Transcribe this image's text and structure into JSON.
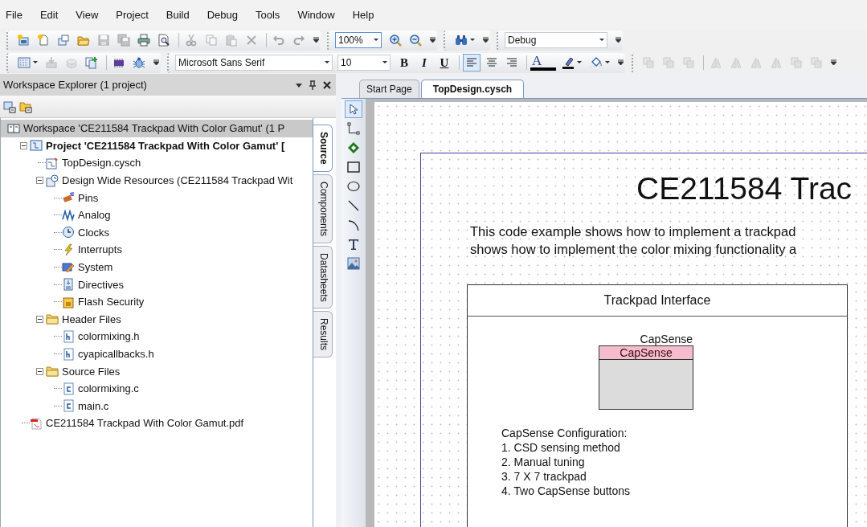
{
  "menu": [
    {
      "label": "File"
    },
    {
      "label": "Edit"
    },
    {
      "label": "View"
    },
    {
      "label": "Project"
    },
    {
      "label": "Build"
    },
    {
      "label": "Debug"
    },
    {
      "label": "Tools"
    },
    {
      "label": "Window"
    },
    {
      "label": "Help"
    }
  ],
  "toolbars": [
    [
      {
        "items": [
          {
            "kind": "icon",
            "disabled": false
          },
          {
            "kind": "icon",
            "disabled": false
          },
          {
            "kind": "icon",
            "disabled": false
          },
          {
            "kind": "icon",
            "disabled": false
          },
          {
            "kind": "icon",
            "disabled": true
          },
          {
            "kind": "icon",
            "disabled": true
          },
          {
            "kind": "icon",
            "disabled": false
          },
          {
            "kind": "icon",
            "disabled": false
          },
          {
            "kind": "separator"
          },
          {
            "kind": "icon",
            "disabled": true
          },
          {
            "kind": "icon",
            "disabled": true
          },
          {
            "kind": "icon",
            "disabled": true
          },
          {
            "kind": "icon",
            "disabled": true
          },
          {
            "kind": "separator"
          },
          {
            "kind": "icon",
            "disabled": true
          },
          {
            "kind": "icon",
            "disabled": true
          }
        ]
      },
      {
        "items": [
          {
            "kind": "combo",
            "value": "100%"
          },
          {
            "kind": "icon",
            "disabled": false
          },
          {
            "kind": "icon",
            "disabled": false
          }
        ]
      },
      {
        "items": [
          {
            "kind": "menu_icon",
            "disabled": false
          }
        ]
      },
      {
        "items": [
          {
            "kind": "combo",
            "value": "Debug"
          }
        ]
      }
    ],
    [
      {
        "items": [
          {
            "kind": "menu_icon",
            "disabled": false
          },
          {
            "kind": "icon",
            "disabled": true
          },
          {
            "kind": "icon",
            "disabled": true
          },
          {
            "kind": "icon",
            "disabled": false
          },
          {
            "kind": "separator"
          },
          {
            "kind": "icon",
            "disabled": false
          },
          {
            "kind": "icon",
            "disabled": false
          }
        ]
      },
      {
        "items": [
          {
            "kind": "combo",
            "value": "Microsoft Sans Serif"
          },
          {
            "kind": "combo",
            "value": "10"
          },
          {
            "kind": "format",
            "label": "B"
          },
          {
            "kind": "format",
            "label": "I"
          },
          {
            "kind": "format",
            "label": "U"
          },
          {
            "kind": "separator"
          },
          {
            "kind": "toggle",
            "selected": true
          },
          {
            "kind": "toggle",
            "selected": false
          },
          {
            "kind": "toggle",
            "selected": false
          },
          {
            "kind": "separator"
          },
          {
            "kind": "text_color",
            "label": "A"
          },
          {
            "kind": "menu_icon",
            "disabled": false
          },
          {
            "kind": "menu_icon",
            "disabled": false
          }
        ]
      },
      {
        "items": [
          {
            "kind": "icon",
            "disabled": true
          },
          {
            "kind": "icon",
            "disabled": true
          },
          {
            "kind": "icon",
            "disabled": true
          },
          {
            "kind": "separator"
          },
          {
            "kind": "icon",
            "disabled": true
          },
          {
            "kind": "icon",
            "disabled": true
          },
          {
            "kind": "icon",
            "disabled": true
          },
          {
            "kind": "icon",
            "disabled": true
          },
          {
            "kind": "icon",
            "disabled": true
          },
          {
            "kind": "icon",
            "disabled": true
          }
        ]
      }
    ]
  ],
  "explorer": {
    "title": "Workspace Explorer (1 project)",
    "tree": [
      {
        "label": "Workspace 'CE211584 Trackpad With Color Gamut' (1 P",
        "kind": "workspace",
        "selected": true,
        "children": [
          {
            "label": "Project  'CE211584 Trackpad With Color Gamut' [",
            "kind": "project",
            "selected": false,
            "active": true,
            "expanded": true,
            "children": [
              {
                "label": "TopDesign.cysch",
                "kind": "schematic",
                "selected": false
              },
              {
                "label": "Design Wide Resources (CE211584 Trackpad Wit",
                "kind": "resources",
                "selected": false,
                "expanded": true,
                "children": [
                  {
                    "label": "Pins",
                    "kind": "pins",
                    "selected": false
                  },
                  {
                    "label": "Analog",
                    "kind": "analog",
                    "selected": false
                  },
                  {
                    "label": "Clocks",
                    "kind": "clocks",
                    "selected": false
                  },
                  {
                    "label": "Interrupts",
                    "kind": "interrupts",
                    "selected": false
                  },
                  {
                    "label": "System",
                    "kind": "system",
                    "selected": false
                  },
                  {
                    "label": "Directives",
                    "kind": "directives",
                    "selected": false
                  },
                  {
                    "label": "Flash Security",
                    "kind": "flash",
                    "selected": false
                  }
                ]
              },
              {
                "label": "Header Files",
                "kind": "folder",
                "selected": false,
                "expanded": true,
                "children": [
                  {
                    "label": "colormixing.h",
                    "kind": "header",
                    "selected": false
                  },
                  {
                    "label": "cyapicallbacks.h",
                    "kind": "header",
                    "selected": false
                  }
                ]
              },
              {
                "label": "Source Files",
                "kind": "folder",
                "selected": false,
                "expanded": true,
                "children": [
                  {
                    "label": "colormixing.c",
                    "kind": "source",
                    "selected": false
                  },
                  {
                    "label": "main.c",
                    "kind": "source",
                    "selected": false
                  }
                ]
              }
            ]
          },
          {
            "label": "CE211584 Trackpad With Color Gamut.pdf",
            "kind": "pdf",
            "selected": false
          }
        ]
      }
    ],
    "side_tabs": [
      {
        "label": "Source",
        "selected": true
      },
      {
        "label": "Components",
        "selected": false
      },
      {
        "label": "Datasheets",
        "selected": false
      },
      {
        "label": "Results",
        "selected": false
      }
    ]
  },
  "editor_tabs": [
    {
      "label": "Start Page",
      "selected": false
    },
    {
      "label": "TopDesign.cysch",
      "selected": true
    }
  ],
  "tools": [
    {
      "kind": "pointer",
      "selected": true
    },
    {
      "kind": "wire",
      "selected": false
    },
    {
      "kind": "port",
      "selected": false
    },
    {
      "kind": "rectangle",
      "selected": false
    },
    {
      "kind": "ellipse",
      "selected": false
    },
    {
      "kind": "line",
      "selected": false
    },
    {
      "kind": "arc",
      "selected": false
    },
    {
      "kind": "text",
      "selected": false
    },
    {
      "kind": "image",
      "selected": false
    }
  ],
  "schematic": {
    "title": "CE211584 Trac",
    "description": [
      "This code example shows how to implement a trackpad",
      "shows how to implement the color mixing functionality a"
    ],
    "block": {
      "title": "Trackpad Interface",
      "component": {
        "instance": "CapSense",
        "type": "CapSense"
      },
      "notes": [
        "CapSense Configuration:",
        "1. CSD sensing method",
        "2. Manual tuning",
        "3. 7 X 7 trackpad",
        "4. Two CapSense buttons"
      ]
    }
  }
}
